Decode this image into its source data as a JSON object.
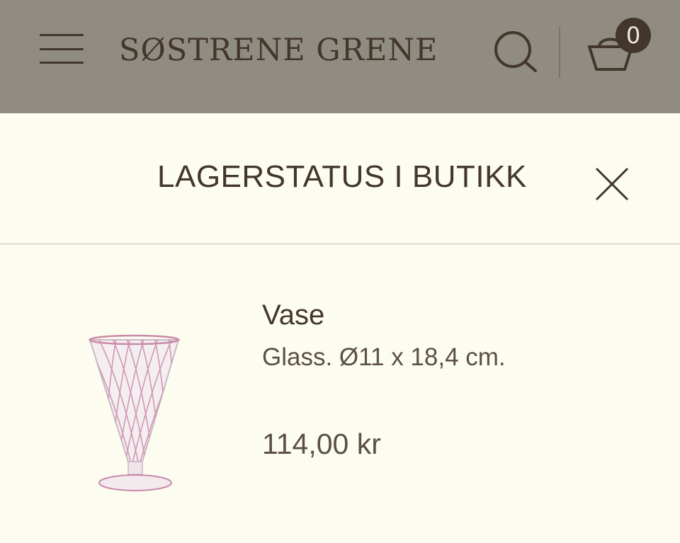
{
  "header": {
    "logo_text": "SØSTRENE GRENE",
    "menu_icon": "hamburger-icon",
    "search_icon": "search-icon",
    "cart_icon": "basket-icon",
    "cart_count": "0"
  },
  "modal": {
    "title": "LAGERSTATUS I BUTIKK",
    "close_icon": "close-icon"
  },
  "product": {
    "name": "Vase",
    "description": "Glass. Ø11 x 18,4 cm.",
    "price": "114,00 kr",
    "image_icon": "vase-image"
  },
  "colors": {
    "header_bg": "#918c82",
    "page_bg": "#fdfcf0",
    "text_dark": "#43362b",
    "text_muted": "#5c5045",
    "vase_accent": "#c98aa8"
  }
}
